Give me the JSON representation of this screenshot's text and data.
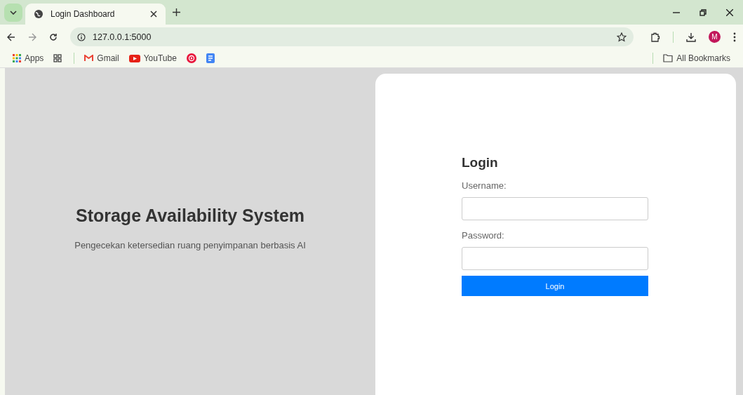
{
  "browser": {
    "tabs": [
      {
        "title": "Login Dashboard",
        "selected": true
      }
    ],
    "address": "127.0.0.1:5000",
    "avatar": "M",
    "bookmarks": [
      {
        "kind": "apps",
        "label": "Apps"
      },
      {
        "kind": "grid"
      },
      {
        "kind": "gmail",
        "label": "Gmail"
      },
      {
        "kind": "youtube",
        "label": "YouTube"
      },
      {
        "kind": "music"
      },
      {
        "kind": "docs"
      }
    ],
    "all_bookmarks": "All Bookmarks"
  },
  "hero": {
    "title": "Storage Availability System",
    "subtitle": "Pengecekan ketersedian ruang penyimpanan berbasis AI"
  },
  "login": {
    "title": "Login",
    "fields": [
      {
        "label": "Username:"
      },
      {
        "label": "Password:"
      }
    ],
    "button": "Login"
  }
}
